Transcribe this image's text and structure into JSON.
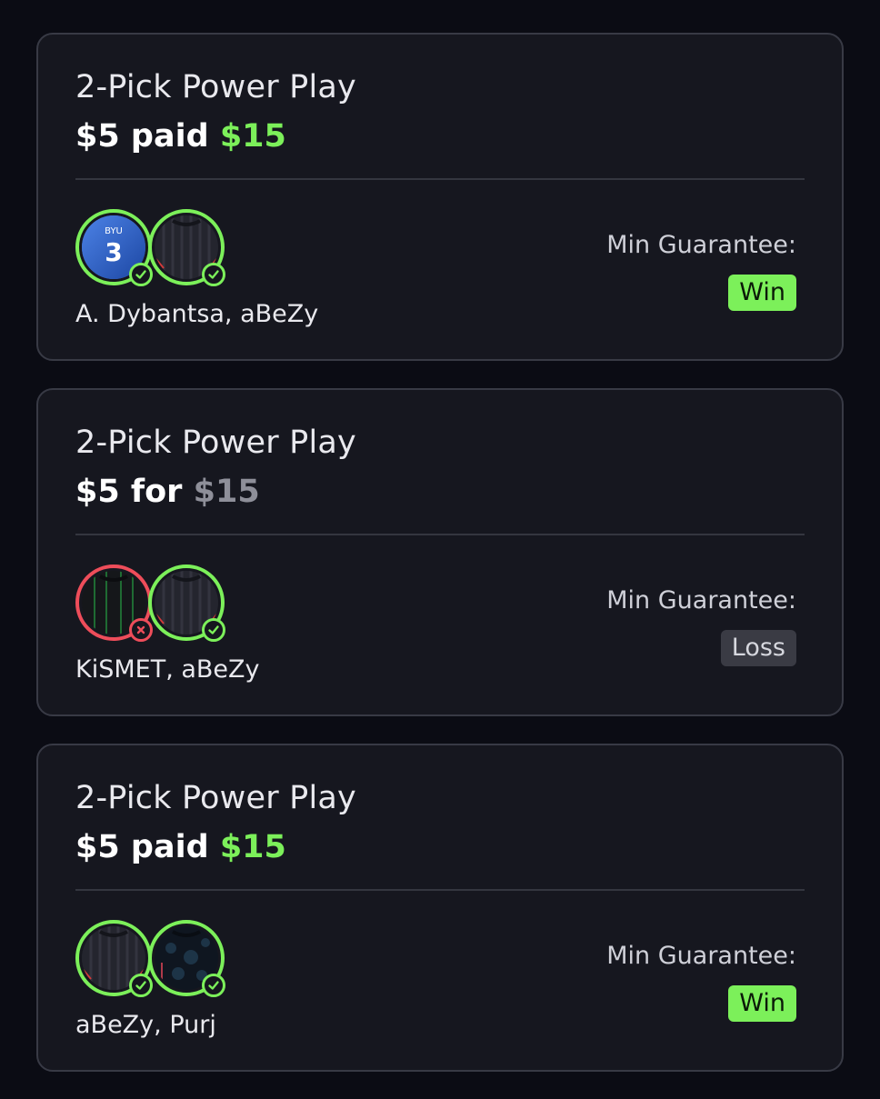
{
  "colors": {
    "background": "#0b0c14",
    "card": "#16171f",
    "accent_win": "#7cf05a",
    "accent_loss": "#ee4d5a",
    "muted": "#8e8f99"
  },
  "entries": [
    {
      "title": "2-Pick Power Play",
      "stake": "$5",
      "connector": "paid",
      "payout": "$15",
      "payout_status": "win",
      "avatars": [
        {
          "jersey": "blue",
          "jersey_text": "BYU",
          "jersey_number": "3",
          "status": "correct",
          "badge_icon": "check-icon"
        },
        {
          "jersey": "dark-striped",
          "status": "correct",
          "badge_icon": "check-icon"
        }
      ],
      "players": "A. Dybantsa, aBeZy",
      "guarantee_label": "Min Guarantee:",
      "result": "Win",
      "result_status": "win"
    },
    {
      "title": "2-Pick Power Play",
      "stake": "$5",
      "connector": "for",
      "payout": "$15",
      "payout_status": "muted",
      "avatars": [
        {
          "jersey": "dark-green-striped",
          "status": "incorrect",
          "badge_icon": "x-icon"
        },
        {
          "jersey": "dark-striped",
          "status": "correct",
          "badge_icon": "check-icon"
        }
      ],
      "players": "KiSMET, aBeZy",
      "guarantee_label": "Min Guarantee:",
      "result": "Loss",
      "result_status": "loss"
    },
    {
      "title": "2-Pick Power Play",
      "stake": "$5",
      "connector": "paid",
      "payout": "$15",
      "payout_status": "win",
      "avatars": [
        {
          "jersey": "dark-striped",
          "status": "correct",
          "badge_icon": "check-icon"
        },
        {
          "jersey": "dark-blue-pattern",
          "status": "correct",
          "badge_icon": "check-icon"
        }
      ],
      "players": "aBeZy, Purj",
      "guarantee_label": "Min Guarantee:",
      "result": "Win",
      "result_status": "win"
    }
  ]
}
